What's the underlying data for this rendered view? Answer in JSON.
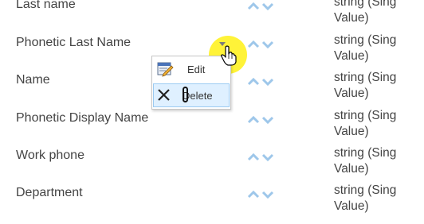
{
  "rows": [
    {
      "name": "Last name",
      "type_line1": "string (Sing",
      "type_line2": "Value)"
    },
    {
      "name": "Phonetic Last Name",
      "type_line1": "string (Sing",
      "type_line2": "Value)"
    },
    {
      "name": "Name",
      "type_line1": "string (Sing",
      "type_line2": "Value)"
    },
    {
      "name": "Phonetic Display Name",
      "type_line1": "string (Sing",
      "type_line2": "Value)"
    },
    {
      "name": "Work phone",
      "type_line1": "string (Sing",
      "type_line2": "Value)"
    },
    {
      "name": "Department",
      "type_line1": "string (Sing",
      "type_line2": "Value)"
    }
  ],
  "context_menu": {
    "edit_label": "Edit",
    "delete_label": "Delete"
  },
  "icons": {
    "arrow_up": "arrow-up-icon",
    "arrow_down": "arrow-down-icon",
    "menu_trigger": "dropdown-triangle-icon",
    "edit": "edit-icon",
    "delete": "delete-x-icon",
    "cursor": "hand-pointer-cursor-icon"
  },
  "colors": {
    "arrow": "#9ec7ea",
    "halo": "#fff000",
    "selected_item_bg": "#dff0ff",
    "selected_item_border": "#9ccbf2",
    "text": "#444444"
  }
}
